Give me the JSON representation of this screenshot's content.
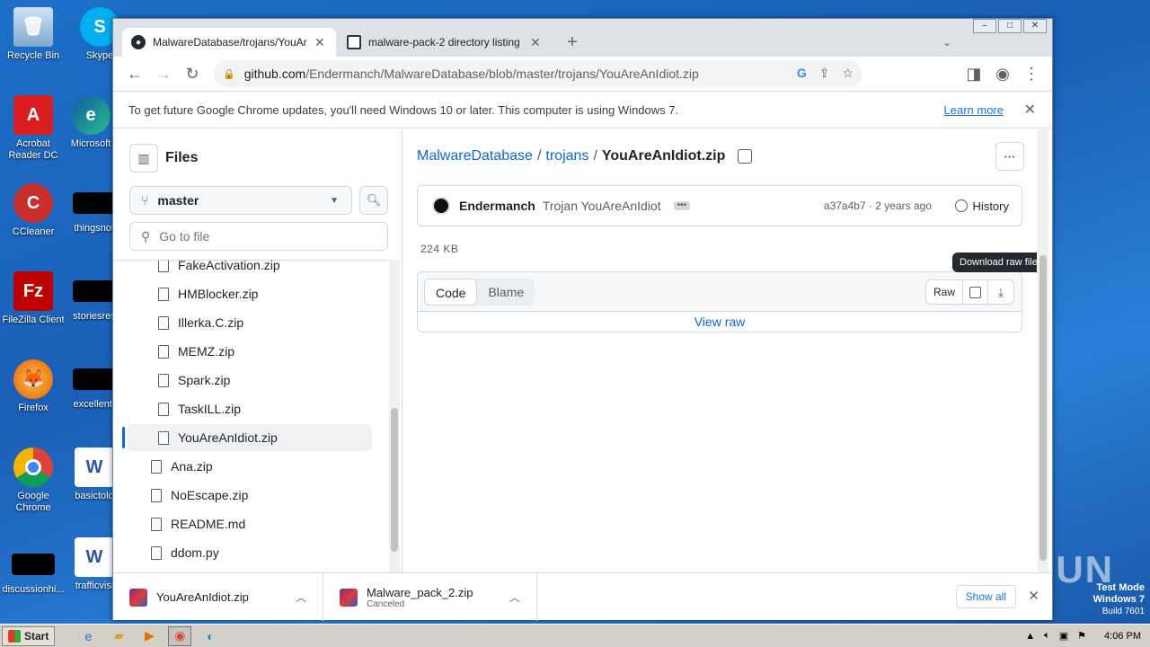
{
  "desktop": {
    "icons": [
      {
        "label": "Recycle Bin"
      },
      {
        "label": "Skype"
      },
      {
        "label": "Acrobat Reader DC"
      },
      {
        "label": "Microsoft"
      },
      {
        "label": "CCleaner"
      },
      {
        "label": "thingsnor"
      },
      {
        "label": "FileZilla Client"
      },
      {
        "label": "storiesres"
      },
      {
        "label": "Firefox"
      },
      {
        "label": "excellentr"
      },
      {
        "label": "Google Chrome"
      },
      {
        "label": "basictolo"
      },
      {
        "label": "discussionhi..."
      },
      {
        "label": "trafficvisi"
      }
    ],
    "watermark": "ANY RUN",
    "testmode": {
      "line1": "Test Mode",
      "line2": "Windows 7",
      "line3": "Build 7601"
    }
  },
  "browser": {
    "tabs": [
      {
        "title": "MalwareDatabase/trojans/YouAreAnIdiot.zip",
        "close": "✕"
      },
      {
        "title": "malware-pack-2 directory listing",
        "close": "✕"
      }
    ],
    "new_tab": "+",
    "address": {
      "host": "github.com",
      "path": "/Endermanch/MalwareDatabase/blob/master/trojans/YouAreAnIdiot.zip"
    },
    "infobar": {
      "message": "To get future Google Chrome updates, you'll need Windows 10 or later. This computer is using Windows 7.",
      "link": "Learn more"
    }
  },
  "github": {
    "sidebar": {
      "title": "Files",
      "branch": "master",
      "goto_placeholder": "Go to file",
      "tree": [
        {
          "name": "FakeActivation.zip",
          "level": 2
        },
        {
          "name": "HMBlocker.zip",
          "level": 2
        },
        {
          "name": "Illerka.C.zip",
          "level": 2
        },
        {
          "name": "MEMZ.zip",
          "level": 2
        },
        {
          "name": "Spark.zip",
          "level": 2
        },
        {
          "name": "TaskILL.zip",
          "level": 2
        },
        {
          "name": "YouAreAnIdiot.zip",
          "level": 2,
          "selected": true
        },
        {
          "name": "Ana.zip",
          "level": 1
        },
        {
          "name": "NoEscape.zip",
          "level": 1
        },
        {
          "name": "README.md",
          "level": 1
        },
        {
          "name": "ddom.py",
          "level": 1
        }
      ]
    },
    "breadcrumb": {
      "repo": "MalwareDatabase",
      "folder": "trojans",
      "file": "YouAreAnIdiot.zip",
      "sep": "/"
    },
    "commit": {
      "author": "Endermanch",
      "message": "Trojan YouAreAnIdiot",
      "meta": "a37a4b7 · 2 years ago",
      "history": "History"
    },
    "file_size": "224 KB",
    "viewer": {
      "code_tab": "Code",
      "blame_tab": "Blame",
      "raw": "Raw",
      "view_raw": "View raw",
      "tooltip": "Download raw file"
    }
  },
  "downloads": [
    {
      "name": "YouAreAnIdiot.zip",
      "status": ""
    },
    {
      "name": "Malware_pack_2.zip",
      "status": "Canceled"
    }
  ],
  "downloads_show_all": "Show all",
  "taskbar": {
    "start": "Start",
    "time": "4:06 PM"
  }
}
